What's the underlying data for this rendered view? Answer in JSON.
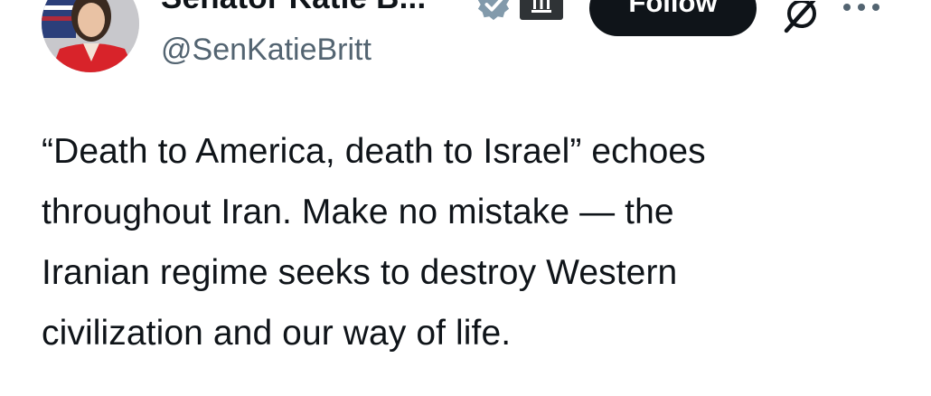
{
  "author": {
    "display_name": "Senator Katie B...",
    "handle": "@SenKatieBritt",
    "verified": true,
    "affiliation_badge_icon": "government-building-icon",
    "avatar_icon": "profile-photo"
  },
  "actions": {
    "follow_label": "Follow",
    "grok_icon": "grok-icon",
    "more_icon": "more-options-icon"
  },
  "tweet": {
    "lines": [
      "“Death to America, death to Israel” echoes",
      "throughout Iran. Make no mistake — the",
      "Iranian regime seeks to destroy Western",
      "civilization and our way of life."
    ]
  },
  "colors": {
    "verified_badge": "#829aab",
    "follow_button_bg": "#0f1419",
    "follow_button_text": "#ffffff",
    "text_primary": "#0f1419",
    "text_secondary": "#536471"
  }
}
